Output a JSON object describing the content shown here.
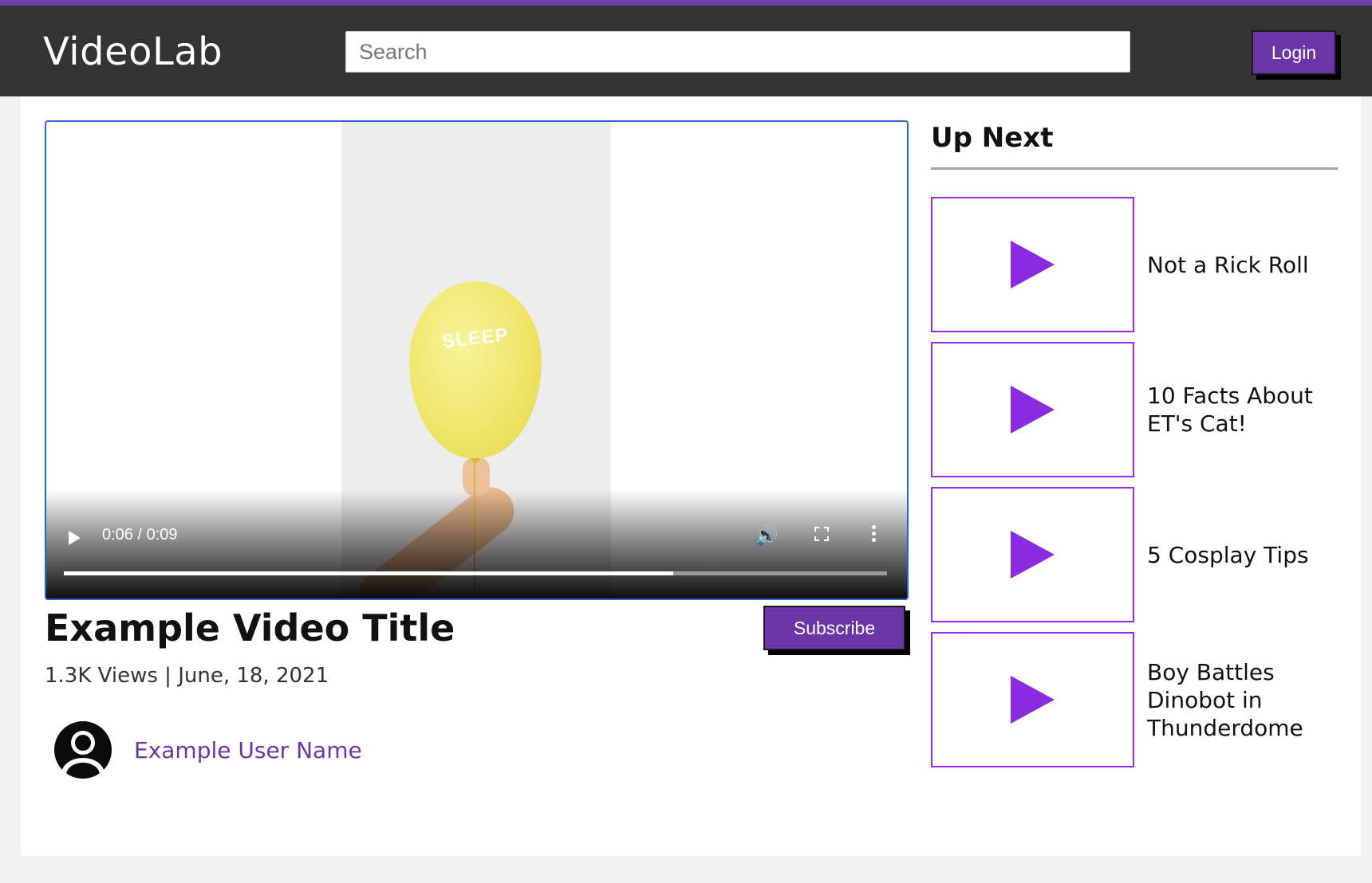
{
  "header": {
    "logo": "VideoLab",
    "search_placeholder": "Search",
    "login_label": "Login"
  },
  "video": {
    "balloon_text": "SLEEP",
    "time": "0:06 / 0:09",
    "progress_fraction": 0.74
  },
  "info": {
    "title": "Example Video Title",
    "meta": "1.3K Views | June, 18, 2021",
    "subscribe_label": "Subscribe",
    "username": "Example User Name"
  },
  "sidebar": {
    "title": "Up Next",
    "items": [
      {
        "title": "Not a Rick Roll"
      },
      {
        "title": "10 Facts About ET's Cat!"
      },
      {
        "title": "5 Cosplay Tips"
      },
      {
        "title": "Boy Battles Dinobot in Thunderdome"
      }
    ]
  },
  "colors": {
    "accent": "#6a36a6",
    "thumb_border": "#9a27ec",
    "play_triangle": "#8a2be2",
    "header_bg": "#333333"
  }
}
